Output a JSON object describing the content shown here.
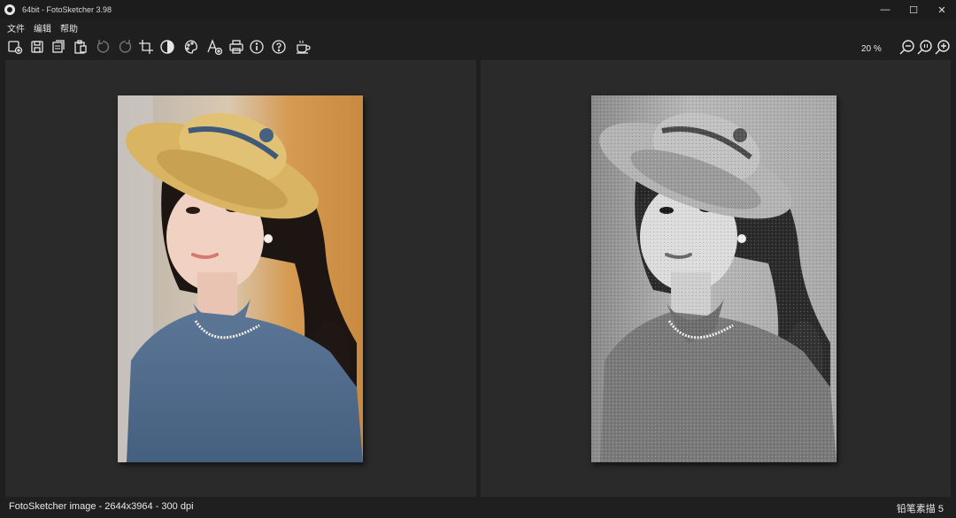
{
  "window": {
    "title": "64bit - FotoSketcher 3.98",
    "minimize": "—",
    "maximize": "☐",
    "close": "✕"
  },
  "menu": [
    "文件",
    "编辑",
    "帮助"
  ],
  "toolbar": {
    "icons": [
      "new-icon",
      "save-icon",
      "copy-icon",
      "paste-icon",
      "undo-icon",
      "redo-icon",
      "crop-icon",
      "contrast-icon",
      "palette-icon",
      "text-add-icon",
      "print-icon",
      "info-icon",
      "help-icon",
      "coffee-icon",
      "zoom-out-icon",
      "zoom-actual-icon",
      "zoom-in-icon"
    ],
    "zoom": "20 %"
  },
  "status": {
    "info": "FotoSketcher image - 2644x3964 - 300 dpi",
    "effect": "铅笔素描 5"
  },
  "colors": {
    "background": "#1f1f1f",
    "panel": "#2a2a2a",
    "text": "#e6e6e6"
  }
}
